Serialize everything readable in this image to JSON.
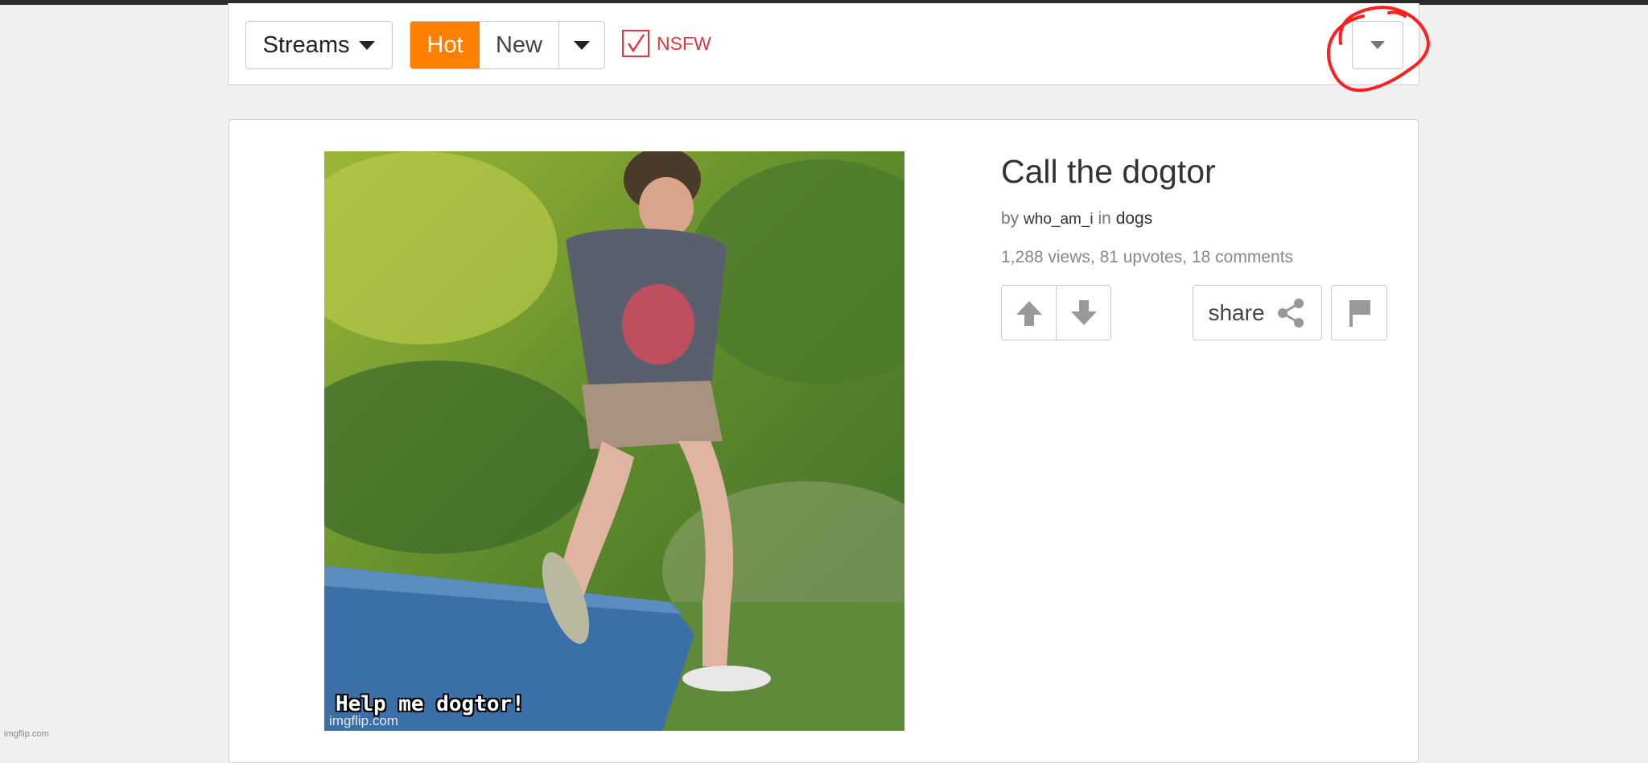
{
  "toolbar": {
    "streams_label": "Streams",
    "sort_hot": "Hot",
    "sort_new": "New",
    "nsfw_label": "NSFW",
    "nsfw_checked": true,
    "accent_color": "#ff7f00",
    "nsfw_color": "#e0383e"
  },
  "post": {
    "title": "Call the dogtor",
    "by_prefix": "by",
    "author": "who_am_i",
    "in_word": "in",
    "stream": "dogs",
    "stats": "1,288 views, 81 upvotes, 18 comments",
    "share_label": "share",
    "image": {
      "caption": "Help me dogtor!",
      "watermark": "imgflip.com"
    }
  },
  "footer": {
    "watermark": "imgflip.com"
  },
  "icons": [
    "chevron-down-icon",
    "checkmark-icon",
    "upvote-arrow-icon",
    "downvote-arrow-icon",
    "share-icon",
    "flag-icon"
  ]
}
